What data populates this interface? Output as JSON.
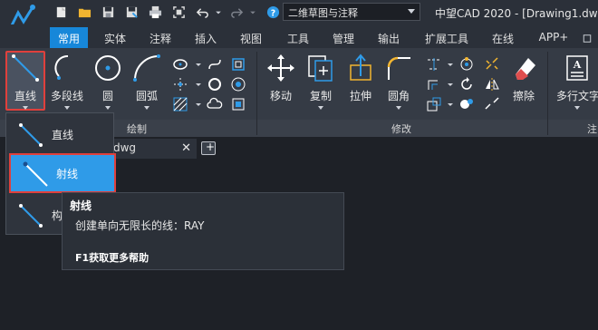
{
  "app": {
    "workspace": "二维草图与注释",
    "title": "中望CAD 2020 - [Drawing1.dw"
  },
  "quick_access": [
    "new-icon",
    "open-icon",
    "save-icon",
    "save-as-icon",
    "print-icon",
    "fit-icon",
    "undo-icon",
    "redo-icon",
    "dropdown-icon",
    "help-icon"
  ],
  "tabs": [
    {
      "label": "常用",
      "active": true
    },
    {
      "label": "实体"
    },
    {
      "label": "注释"
    },
    {
      "label": "插入"
    },
    {
      "label": "视图"
    },
    {
      "label": "工具"
    },
    {
      "label": "管理"
    },
    {
      "label": "输出"
    },
    {
      "label": "扩展工具"
    },
    {
      "label": "在线"
    },
    {
      "label": "APP+"
    }
  ],
  "ribbon": {
    "draw": {
      "line": "直线",
      "polyline": "多段线",
      "circle": "圆",
      "arc": "圆弧",
      "panel_label": "绘制"
    },
    "modify": {
      "move": "移动",
      "copy": "复制",
      "stretch": "拉伸",
      "fillet": "圆角",
      "erase": "擦除",
      "panel_label": "修改"
    },
    "annotation": {
      "mtext": "多行文字",
      "panel_label": "注"
    }
  },
  "document": {
    "tab_name": "dwg",
    "close": "✕",
    "new_tab": "+"
  },
  "dropdown": {
    "items": [
      {
        "label": "直线"
      },
      {
        "label": "射线",
        "selected": true
      },
      {
        "label": "构"
      }
    ]
  },
  "tooltip": {
    "title": "射线",
    "description": "创建单向无限长的线：RAY",
    "help": "F1获取更多帮助"
  },
  "colors": {
    "accent": "#1787d9",
    "highlight_border": "#e0403c",
    "selected_item": "#2f9be8"
  }
}
